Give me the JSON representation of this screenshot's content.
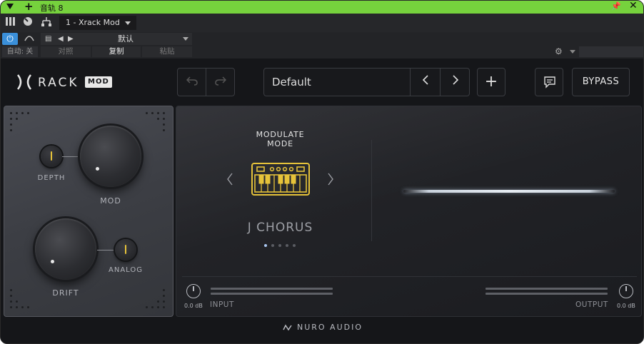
{
  "host": {
    "title": "音轨 8",
    "track_selector": "1 - Xrack Mod",
    "preset_value": "默认",
    "auto_label": "自动: 关",
    "compare_label": "对照",
    "copy_label": "复制",
    "paste_label": "粘贴"
  },
  "plugin": {
    "logo_text": "RACK",
    "logo_badge": "MOD",
    "preset_name": "Default",
    "bypass_label": "BYPASS",
    "knobs": {
      "depth_label": "DEPTH",
      "mod_label": "MOD",
      "drift_label": "DRIFT",
      "analog_label": "ANALOG"
    },
    "modulate_mode_title": "MODULATE MODE",
    "mode_name": "J CHORUS",
    "mode_page_index": 1,
    "mode_page_count": 5,
    "input": {
      "label": "INPUT",
      "gain": "0.0 dB"
    },
    "output": {
      "label": "OUTPUT",
      "gain": "0.0 dB"
    },
    "footer_brand": "NURO AUDIO"
  },
  "colors": {
    "titlebar_green": "#76d23d",
    "power_blue": "#3a8fd9",
    "accent_yellow": "#e6c33a",
    "bg_dark": "#151619"
  }
}
